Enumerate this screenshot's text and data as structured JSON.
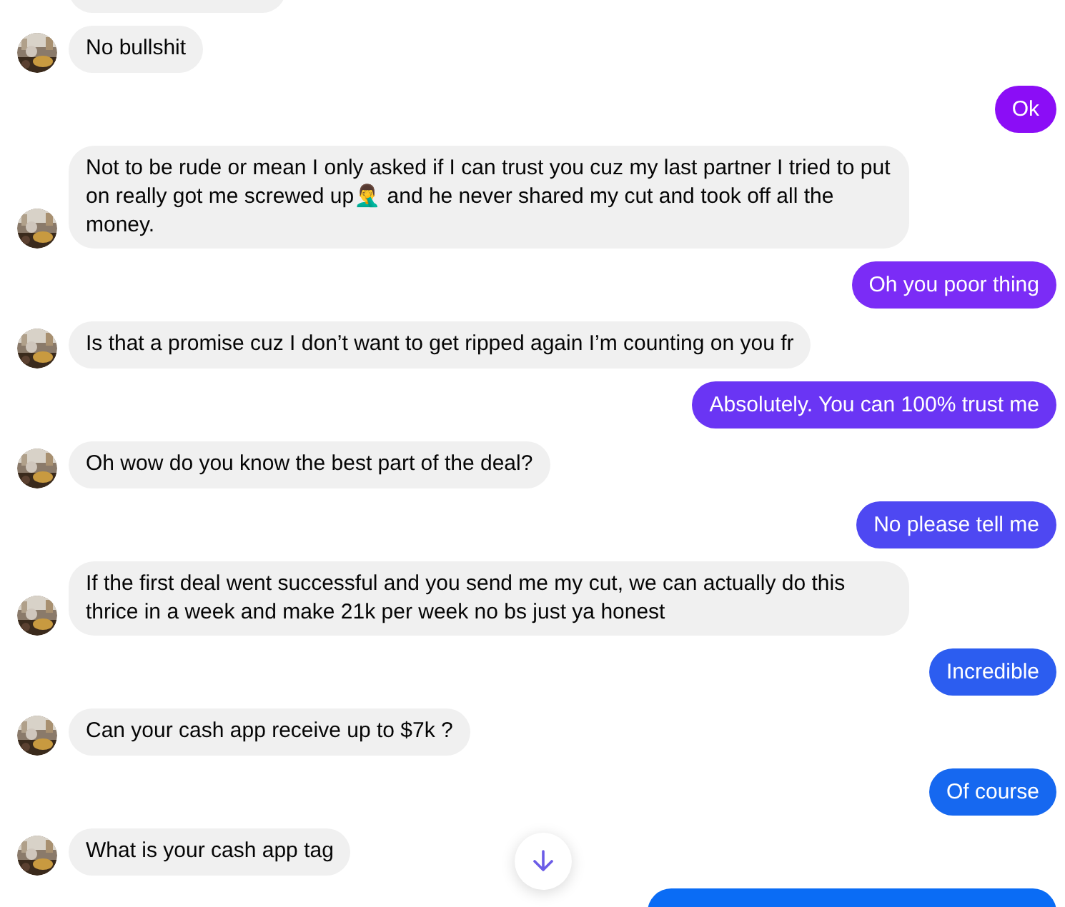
{
  "messages": [
    {
      "kind": "incoming",
      "avatar": false
    },
    {
      "kind": "incoming",
      "text": "No bullshit",
      "avatar": true
    },
    {
      "kind": "outgoing",
      "text": "Ok",
      "color": "#8b0df6"
    },
    {
      "kind": "incoming",
      "text": "Not to be rude or mean I only asked if I can trust you cuz my last partner I tried to put on really got me screwed up🤦‍♂️ and he never shared my cut and took off all the money.",
      "avatar": true
    },
    {
      "kind": "outgoing",
      "text": "Oh you poor thing",
      "color": "#7b2cf6"
    },
    {
      "kind": "incoming",
      "text": "Is that a promise cuz I don’t want to get ripped again I’m counting on you fr",
      "avatar": true
    },
    {
      "kind": "outgoing",
      "text": "Absolutely. You can 100% trust me",
      "color": "#6a35f4"
    },
    {
      "kind": "incoming",
      "text": "Oh wow do you know the best part of the deal?",
      "avatar": true
    },
    {
      "kind": "outgoing",
      "text": "No please tell me",
      "color": "#4e48f2"
    },
    {
      "kind": "incoming",
      "text": "If the first deal went successful and you send me my cut, we can actually do this thrice in a week and make 21k per week no bs just ya honest",
      "avatar": true
    },
    {
      "kind": "outgoing",
      "text": "Incredible",
      "color": "#2c5df0"
    },
    {
      "kind": "incoming",
      "text": "Can your cash app receive up to $7k ?",
      "avatar": true
    },
    {
      "kind": "outgoing",
      "text": "Of course",
      "color": "#1668f0"
    },
    {
      "kind": "incoming",
      "text": "What is your cash app tag",
      "avatar": true
    },
    {
      "kind": "outgoing",
      "color": "#0a6cf5"
    }
  ]
}
